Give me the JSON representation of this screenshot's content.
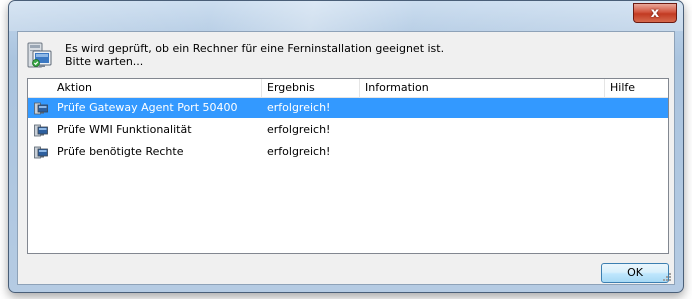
{
  "dialog": {
    "message_line1": "Es wird geprüft, ob ein Rechner für eine Ferninstallation geeignet ist.",
    "message_line2": "Bitte warten...",
    "close_label": "x",
    "icon": "computer-check-icon"
  },
  "table": {
    "columns": [
      "Aktion",
      "Ergebnis",
      "Information",
      "Hilfe"
    ],
    "rows": [
      {
        "action": "Prüfe Gateway Agent Port 50400",
        "result": "erfolgreich!",
        "info": "",
        "help": "",
        "selected": true,
        "icon": "computer-icon"
      },
      {
        "action": "Prüfe WMI Funktionalität",
        "result": "erfolgreich!",
        "info": "",
        "help": "",
        "selected": false,
        "icon": "computer-icon"
      },
      {
        "action": "Prüfe benötigte Rechte",
        "result": "erfolgreich!",
        "info": "",
        "help": "",
        "selected": false,
        "icon": "computer-icon"
      }
    ]
  },
  "buttons": {
    "ok_label": "OK"
  },
  "colors": {
    "selection": "#3399ff",
    "close_button": "#c23a22",
    "title_bar": "#b6cde5"
  }
}
